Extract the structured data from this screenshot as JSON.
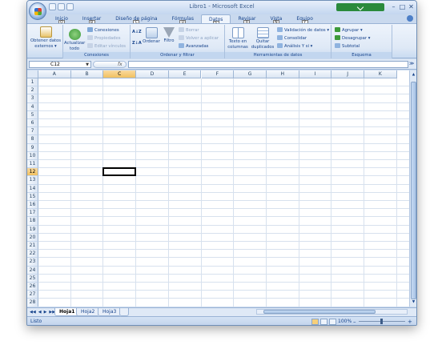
{
  "window": {
    "title": "Libro1 - Microsoft Excel",
    "minimize": "–",
    "maximize": "□",
    "close": "✕"
  },
  "qat": [
    "save-icon",
    "undo-icon",
    "redo-icon",
    "customize-icon"
  ],
  "tabs": [
    {
      "label": "Inicio",
      "keytip": "O"
    },
    {
      "label": "Insertar",
      "keytip": "B"
    },
    {
      "label": "Diseño de página",
      "keytip": "C"
    },
    {
      "label": "Fórmulas",
      "keytip": "U"
    },
    {
      "label": "Datos",
      "keytip": "S",
      "active": true
    },
    {
      "label": "Revisar",
      "keytip": "R"
    },
    {
      "label": "Vista",
      "keytip": "N"
    },
    {
      "label": "Equipo",
      "keytip": "Y"
    }
  ],
  "ribbon": {
    "ext": {
      "label": "Obtener datos externos",
      "arrow": "▾"
    },
    "conexiones": {
      "refresh": "Actualizar todo",
      "items": [
        "Conexiones",
        "Propiedades",
        "Editar vínculos"
      ],
      "group": "Conexiones"
    },
    "ordenar": {
      "az": "A↓Z",
      "za": "Z↓A",
      "sort": "Ordenar",
      "filter": "Filtro",
      "items": [
        "Borrar",
        "Volver a aplicar",
        "Avanzadas"
      ],
      "group": "Ordenar y filtrar"
    },
    "herramientas": {
      "text": "Texto en columnas",
      "dupes": "Quitar duplicados",
      "items": [
        "Validación de datos",
        "Consolidar",
        "Análisis Y si"
      ],
      "group": "Herramientas de datos"
    },
    "esquema": {
      "items": [
        "Agrupar",
        "Desagrupar",
        "Subtotal"
      ],
      "group": "Esquema"
    }
  },
  "formula": {
    "namebox": "C12",
    "fx": "fx",
    "value": ""
  },
  "columns": [
    "A",
    "B",
    "C",
    "D",
    "E",
    "F",
    "G",
    "H",
    "I",
    "J",
    "K"
  ],
  "selected": {
    "column": "C",
    "row": 12
  },
  "rows": [
    "1",
    "2",
    "3",
    "4",
    "5",
    "6",
    "7",
    "8",
    "9",
    "10",
    "11",
    "12",
    "13",
    "14",
    "15",
    "16",
    "17",
    "18",
    "19",
    "20",
    "21",
    "22",
    "23",
    "24",
    "25",
    "26",
    "27",
    "28"
  ],
  "sheets": [
    {
      "label": "Hoja1",
      "active": true
    },
    {
      "label": "Hoja2"
    },
    {
      "label": "Hoja3"
    }
  ],
  "sheetnav": [
    "◀◀",
    "◀",
    "▶",
    "▶▶"
  ],
  "status": {
    "text": "Listo",
    "zoom": "100%",
    "minus": "–",
    "plus": "+"
  },
  "colors": {
    "accent": "#15428b",
    "selection": "#f1c15f"
  }
}
